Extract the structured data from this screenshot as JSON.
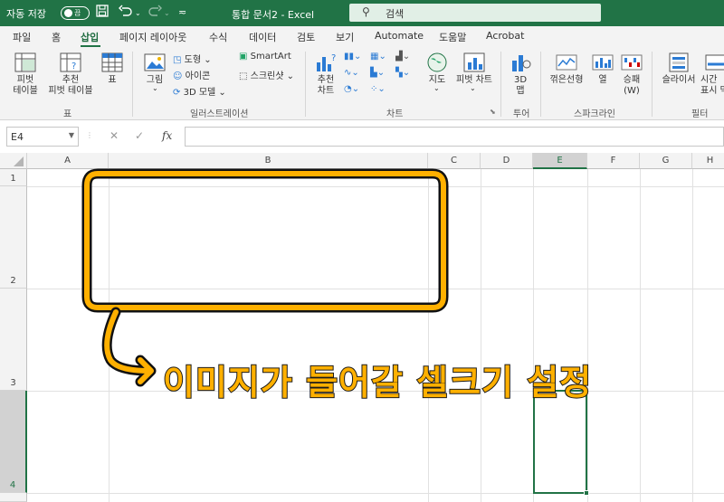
{
  "titlebar": {
    "autosave_label": "자동 저장",
    "autosave_state": "끔",
    "doc_title": "통합 문서2  -  Excel",
    "search_placeholder": "검색"
  },
  "tabs": [
    "파일",
    "홈",
    "삽입",
    "페이지 레이아웃",
    "수식",
    "데이터",
    "검토",
    "보기",
    "Automate",
    "도움말",
    "Acrobat"
  ],
  "active_tab": "삽입",
  "ribbon": {
    "pivot_table": "피벗\n테이블",
    "recommended_pivot": "추천\n피벗 테이블",
    "table": "표",
    "picture": "그림",
    "shapes": "도형",
    "icons": "아이콘",
    "models_3d": "3D 모델",
    "smartart": "SmartArt",
    "screenshot": "스크린샷",
    "recommended_charts": "추천\n차트",
    "maps": "지도",
    "pivot_chart": "피벗 차트",
    "map_3d": "3D\n맵",
    "line": "꺾은선형",
    "column": "열",
    "winloss": "승패\n(W)",
    "slicer": "슬라이서",
    "timeline": "시간\n표시 막",
    "groups": {
      "tables": "표",
      "illustrations": "일러스트레이션",
      "charts": "차트",
      "tours": "투어",
      "sparklines": "스파크라인",
      "filters": "필터"
    }
  },
  "formula_bar": {
    "name_box": "E4",
    "fx": "fx",
    "cancel": "✕",
    "enter": "✓",
    "value": ""
  },
  "grid": {
    "columns": [
      "A",
      "B",
      "C",
      "D",
      "E",
      "F",
      "G",
      "H"
    ],
    "rows": [
      "1",
      "2",
      "3",
      "4"
    ],
    "selected_cell": "E4"
  },
  "annotation": {
    "text": "이미지가 들어갈 셀크기 설정",
    "color": "#ffb000"
  },
  "colors": {
    "excel_green": "#217346",
    "ribbon_bg": "#f3f3f3"
  }
}
